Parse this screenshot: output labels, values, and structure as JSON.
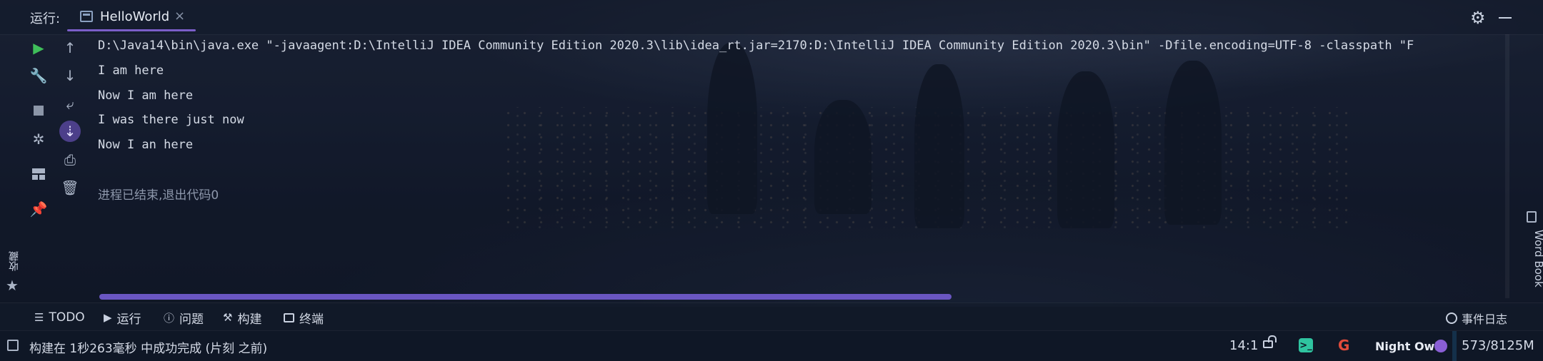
{
  "header": {
    "run_label": "运行:",
    "tab_title": "HelloWorld",
    "close_glyph": "×",
    "settings_icon": "gear-icon",
    "minimize_icon": "minimize-icon"
  },
  "console": {
    "command": "D:\\Java14\\bin\\java.exe \"-javaagent:D:\\IntelliJ IDEA Community Edition 2020.3\\lib\\idea_rt.jar=2170:D:\\IntelliJ IDEA Community Edition 2020.3\\bin\" -Dfile.encoding=UTF-8 -classpath \"F",
    "lines": [
      "I am here",
      "Now I am here",
      "I was there just now",
      "Now I an here"
    ],
    "exit_message": "进程已结束,退出代码0"
  },
  "side_strips": {
    "favorites_label": "收藏",
    "wordbook_label": "Word Book"
  },
  "tool_tabs": {
    "todo": "TODO",
    "run": "运行",
    "problems": "问题",
    "build": "构建",
    "terminal": "终端",
    "event_log": "事件日志"
  },
  "status": {
    "message": "构建在 1秒263毫秒 中成功完成 (片刻 之前)",
    "position": "14:1",
    "google_glyph": "G",
    "terminal_glyph": ">_",
    "theme": "Night Owl",
    "memory": "573/8125M",
    "theme_color": "#8a5fd6",
    "accent_color": "#7b5ec9"
  }
}
